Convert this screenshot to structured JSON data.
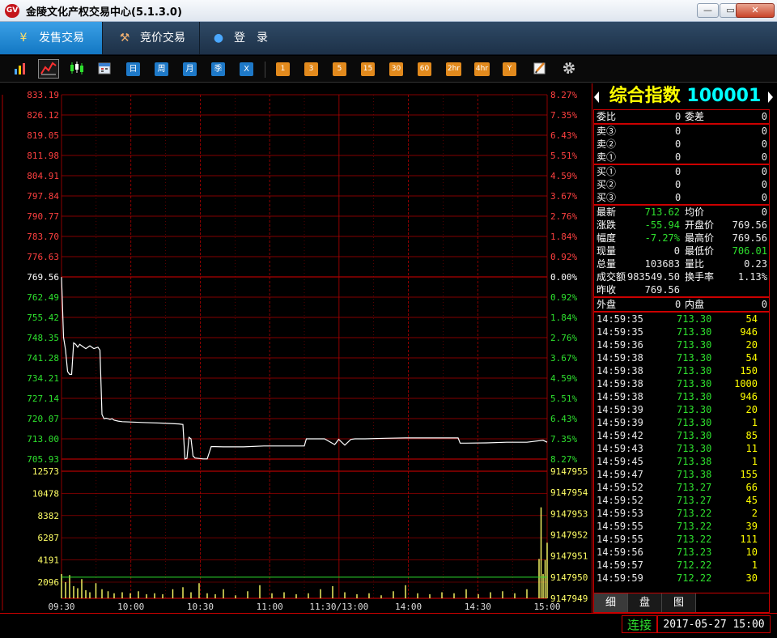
{
  "window": {
    "title": "金陵文化产权交易中心(5.1.3.0)",
    "logo_text": "GV",
    "minimize": "—",
    "maximize": "▭",
    "close": "✕"
  },
  "nav": {
    "tabs": [
      {
        "label": "发售交易",
        "icon": "¥"
      },
      {
        "label": "竞价交易",
        "icon": "⚒"
      },
      {
        "label": "登　录",
        "icon": "●"
      }
    ]
  },
  "toolbar": {
    "view_icons": [
      "bar-chart-icon",
      "line-chart-icon",
      "candlestick-icon",
      "calendar-icon"
    ],
    "periods": [
      "日",
      "周",
      "月",
      "季",
      "X"
    ],
    "minutes": [
      "1",
      "3",
      "5",
      "15",
      "30",
      "60",
      "2hr",
      "4hr",
      "Y"
    ],
    "tools": [
      "draw-icon",
      "gear-icon"
    ]
  },
  "quote": {
    "name": "综合指数",
    "code": "100001",
    "weibi": {
      "label": "委比",
      "value": "0",
      "label2": "委差",
      "value2": "0"
    },
    "sells": [
      {
        "label": "卖③",
        "price": "0",
        "vol": "0"
      },
      {
        "label": "卖②",
        "price": "0",
        "vol": "0"
      },
      {
        "label": "卖①",
        "price": "0",
        "vol": "0"
      }
    ],
    "buys": [
      {
        "label": "买①",
        "price": "0",
        "vol": "0"
      },
      {
        "label": "买②",
        "price": "0",
        "vol": "0"
      },
      {
        "label": "买③",
        "price": "0",
        "vol": "0"
      }
    ],
    "stats": [
      {
        "l1": "最新",
        "v1": "713.62",
        "c1": "green",
        "l2": "均价",
        "v2": "0",
        "c2": "white"
      },
      {
        "l1": "涨跌",
        "v1": "-55.94",
        "c1": "green",
        "l2": "开盘价",
        "v2": "769.56",
        "c2": "white"
      },
      {
        "l1": "幅度",
        "v1": "-7.27%",
        "c1": "green",
        "l2": "最高价",
        "v2": "769.56",
        "c2": "white"
      },
      {
        "l1": "现量",
        "v1": "0",
        "c1": "white",
        "l2": "最低价",
        "v2": "706.01",
        "c2": "green"
      },
      {
        "l1": "总量",
        "v1": "103683",
        "c1": "white",
        "l2": "量比",
        "v2": "0.23",
        "c2": "white"
      },
      {
        "l1": "成交额",
        "v1": "983549.50",
        "c1": "white",
        "l2": "换手率",
        "v2": "1.13%",
        "c2": "white"
      },
      {
        "l1": "昨收",
        "v1": "769.56",
        "c1": "white",
        "l2": "",
        "v2": "",
        "c2": "white"
      }
    ],
    "waipan": {
      "label": "外盘",
      "value": "0",
      "label2": "内盘",
      "value2": "0"
    },
    "ticks": [
      {
        "time": "14:59:35",
        "price": "713.30",
        "vol": "54"
      },
      {
        "time": "14:59:35",
        "price": "713.30",
        "vol": "946"
      },
      {
        "time": "14:59:36",
        "price": "713.30",
        "vol": "20"
      },
      {
        "time": "14:59:38",
        "price": "713.30",
        "vol": "54"
      },
      {
        "time": "14:59:38",
        "price": "713.30",
        "vol": "150"
      },
      {
        "time": "14:59:38",
        "price": "713.30",
        "vol": "1000"
      },
      {
        "time": "14:59:38",
        "price": "713.30",
        "vol": "946"
      },
      {
        "time": "14:59:39",
        "price": "713.30",
        "vol": "20"
      },
      {
        "time": "14:59:39",
        "price": "713.30",
        "vol": "1"
      },
      {
        "time": "14:59:42",
        "price": "713.30",
        "vol": "85"
      },
      {
        "time": "14:59:43",
        "price": "713.30",
        "vol": "11"
      },
      {
        "time": "14:59:45",
        "price": "713.38",
        "vol": "1"
      },
      {
        "time": "14:59:47",
        "price": "713.38",
        "vol": "155"
      },
      {
        "time": "14:59:52",
        "price": "713.27",
        "vol": "66"
      },
      {
        "time": "14:59:52",
        "price": "713.27",
        "vol": "45"
      },
      {
        "time": "14:59:53",
        "price": "713.22",
        "vol": "2"
      },
      {
        "time": "14:59:55",
        "price": "713.22",
        "vol": "39"
      },
      {
        "time": "14:59:55",
        "price": "713.22",
        "vol": "111"
      },
      {
        "time": "14:59:56",
        "price": "713.23",
        "vol": "10"
      },
      {
        "time": "14:59:57",
        "price": "712.22",
        "vol": "1"
      },
      {
        "time": "14:59:59",
        "price": "712.22",
        "vol": "30"
      }
    ],
    "tabs": [
      "细",
      "盘",
      "图"
    ]
  },
  "status": {
    "connection": "连接",
    "datetime": "2017-05-27 15:00"
  },
  "colors": {
    "up": "#ff4040",
    "down": "#2ee02e",
    "grid": "#b00000",
    "price_line": "#ffffff",
    "volume": "#ffff66",
    "volume_line": "#2ee02e"
  },
  "chart_data": {
    "type": "line",
    "price_axis": [
      "833.19",
      "826.12",
      "819.05",
      "811.98",
      "804.91",
      "797.84",
      "790.77",
      "783.70",
      "776.63",
      "769.56",
      "762.49",
      "755.42",
      "748.35",
      "741.28",
      "734.21",
      "727.14",
      "720.07",
      "713.00",
      "705.93"
    ],
    "pct_axis": [
      "8.27%",
      "7.35%",
      "6.43%",
      "5.51%",
      "4.59%",
      "3.67%",
      "2.76%",
      "1.84%",
      "0.92%",
      "0.00%",
      "0.92%",
      "1.84%",
      "2.76%",
      "3.67%",
      "4.59%",
      "5.51%",
      "6.43%",
      "7.35%",
      "8.27%"
    ],
    "prev_close": 769.56,
    "ylim": [
      705.93,
      833.19
    ],
    "volume_axis": [
      "12573",
      "10478",
      "8382",
      "6287",
      "4191",
      "2096"
    ],
    "volume_right_axis": [
      "9147955",
      "9147954",
      "9147953",
      "9147952",
      "9147951",
      "9147950",
      "9147949"
    ],
    "volume_ylim": [
      0,
      12573
    ],
    "time_labels": [
      "09:30",
      "10:00",
      "10:30",
      "11:00",
      "11:30/13:00",
      "14:00",
      "14:30",
      "15:00"
    ],
    "x_minutes": [
      0,
      240
    ],
    "series": [
      {
        "x": [
          0,
          1,
          2,
          3,
          4,
          5,
          6,
          7,
          8,
          9,
          10,
          12,
          14,
          16,
          18,
          19,
          20,
          21,
          22,
          23,
          24,
          25,
          26,
          28,
          30,
          40,
          50,
          58,
          60,
          61,
          62,
          63,
          64,
          65,
          66,
          70,
          72,
          74,
          80,
          90,
          100,
          110,
          120,
          121,
          122,
          130,
          135,
          137,
          140,
          143,
          145,
          150,
          160,
          170,
          180,
          196,
          197,
          200,
          210,
          220,
          230,
          238,
          240
        ],
        "y": [
          769.5,
          748.5,
          744.0,
          736.5,
          735.5,
          735.5,
          746.5,
          746.0,
          745.0,
          746.0,
          745.5,
          744.5,
          745.5,
          744.5,
          745.0,
          744.0,
          721.5,
          720.0,
          720.2,
          720.0,
          719.8,
          720.0,
          719.5,
          719.2,
          719.0,
          718.7,
          718.5,
          718.2,
          718.0,
          706.0,
          706.2,
          713.5,
          713.0,
          707.0,
          706.3,
          706.0,
          706.0,
          710.3,
          710.2,
          710.2,
          710.5,
          710.5,
          710.5,
          713.0,
          713.0,
          713.0,
          711.0,
          712.8,
          710.8,
          712.8,
          713.0,
          713.0,
          713.2,
          713.3,
          713.3,
          713.3,
          711.5,
          711.5,
          711.6,
          711.8,
          711.8,
          712.5,
          711.8
        ]
      }
    ],
    "volumes": {
      "x": [
        0,
        2,
        4,
        6,
        8,
        10,
        12,
        14,
        17,
        20,
        23,
        26,
        30,
        34,
        38,
        42,
        46,
        50,
        55,
        60,
        64,
        68,
        72,
        76,
        80,
        86,
        92,
        98,
        104,
        110,
        116,
        122,
        128,
        134,
        140,
        146,
        152,
        158,
        164,
        170,
        176,
        182,
        188,
        194,
        200,
        206,
        212,
        218,
        224,
        230,
        236,
        237,
        238,
        239,
        240
      ],
      "v": [
        2400,
        1600,
        2300,
        1200,
        1000,
        1900,
        800,
        600,
        1500,
        900,
        700,
        500,
        600,
        500,
        700,
        400,
        500,
        400,
        900,
        1100,
        600,
        1500,
        500,
        400,
        900,
        300,
        700,
        1300,
        500,
        600,
        400,
        500,
        900,
        1200,
        600,
        400,
        500,
        300,
        700,
        1300,
        500,
        400,
        600,
        500,
        900,
        400,
        600,
        700,
        500,
        900,
        3900,
        9000,
        2400,
        3800,
        5500
      ]
    },
    "volume_baseline": 2096
  }
}
